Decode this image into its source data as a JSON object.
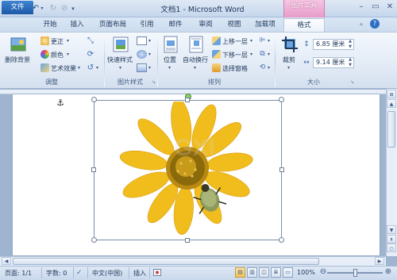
{
  "window": {
    "title": "文档1 - Microsoft Word",
    "contextual_group": "图片工具"
  },
  "tabs": [
    {
      "label": "文件"
    },
    {
      "label": "开始"
    },
    {
      "label": "插入"
    },
    {
      "label": "页面布局"
    },
    {
      "label": "引用"
    },
    {
      "label": "邮件"
    },
    {
      "label": "审阅"
    },
    {
      "label": "视图"
    },
    {
      "label": "加载项"
    },
    {
      "label": "格式"
    }
  ],
  "ribbon": {
    "adjust": {
      "label": "调整",
      "remove_bg": "删除背景",
      "corrections": "更正",
      "color": "颜色",
      "artistic": "艺术效果"
    },
    "picture_styles": {
      "label": "图片样式",
      "quick_styles": "快速样式"
    },
    "arrange": {
      "label": "排列",
      "position": "位置",
      "wrap_text": "自动换行",
      "bring_forward": "上移一层",
      "send_backward": "下移一层",
      "selection_pane": "选择窗格"
    },
    "size": {
      "label": "大小",
      "crop": "裁剪",
      "height": "6.85 厘米",
      "width": "9.14 厘米"
    }
  },
  "statusbar": {
    "page": "页面: 1/1",
    "words": "字数: 0",
    "language": "中文(中国)",
    "mode": "插入",
    "zoom": "100%"
  },
  "watermark": "GXI"
}
